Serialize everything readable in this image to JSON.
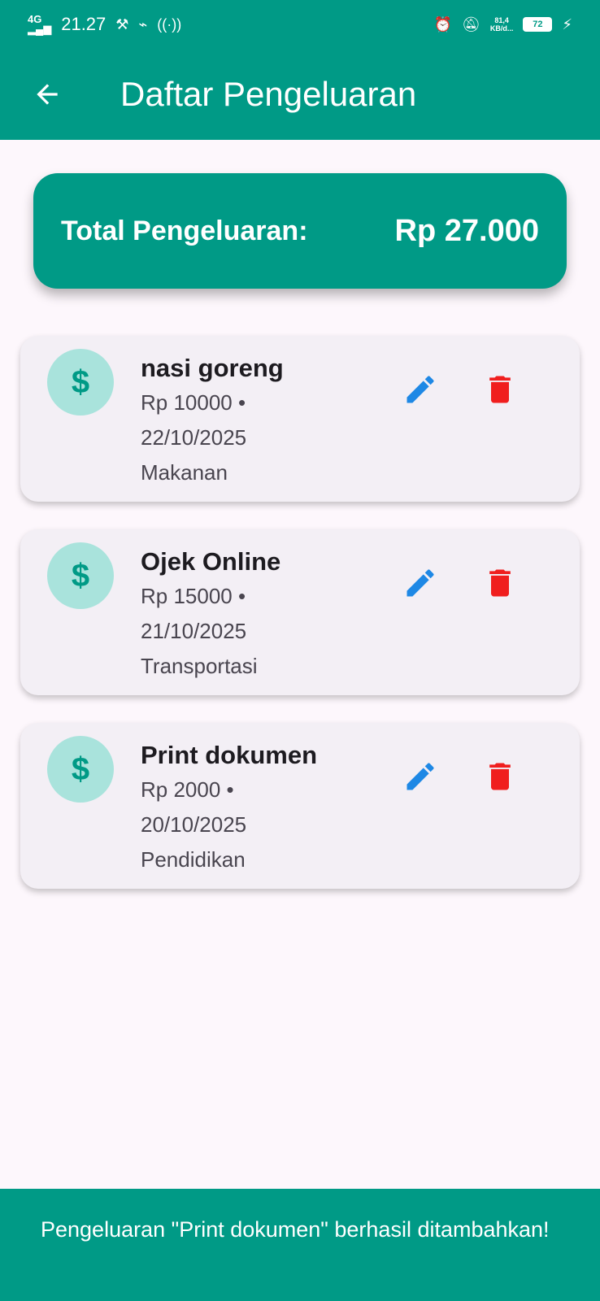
{
  "status_bar": {
    "network": "4G",
    "time": "21.27",
    "speed_value": "81,4",
    "speed_unit": "KB/d...",
    "battery": "72"
  },
  "app_bar": {
    "title": "Daftar Pengeluaran",
    "back_icon": "arrow-left-icon"
  },
  "summary": {
    "label": "Total Pengeluaran:",
    "value": "Rp 27.000"
  },
  "expenses": [
    {
      "name": "nasi goreng",
      "amount_line": "Rp 10000 •",
      "date": "22/10/2025",
      "category": "Makanan"
    },
    {
      "name": "Ojek Online",
      "amount_line": "Rp 15000 •",
      "date": "21/10/2025",
      "category": "Transportasi"
    },
    {
      "name": "Print dokumen",
      "amount_line": "Rp 2000 •",
      "date": "20/10/2025",
      "category": "Pendidikan"
    }
  ],
  "snackbar": {
    "message": "Pengeluaran \"Print dokumen\" berhasil ditambahkan!"
  },
  "colors": {
    "primary": "#009A86",
    "avatar_bg": "#A9E3DC",
    "edit": "#1E88E5",
    "delete": "#F01E1E",
    "card_bg": "#F3EFF5",
    "page_bg": "#FDF7FC"
  }
}
